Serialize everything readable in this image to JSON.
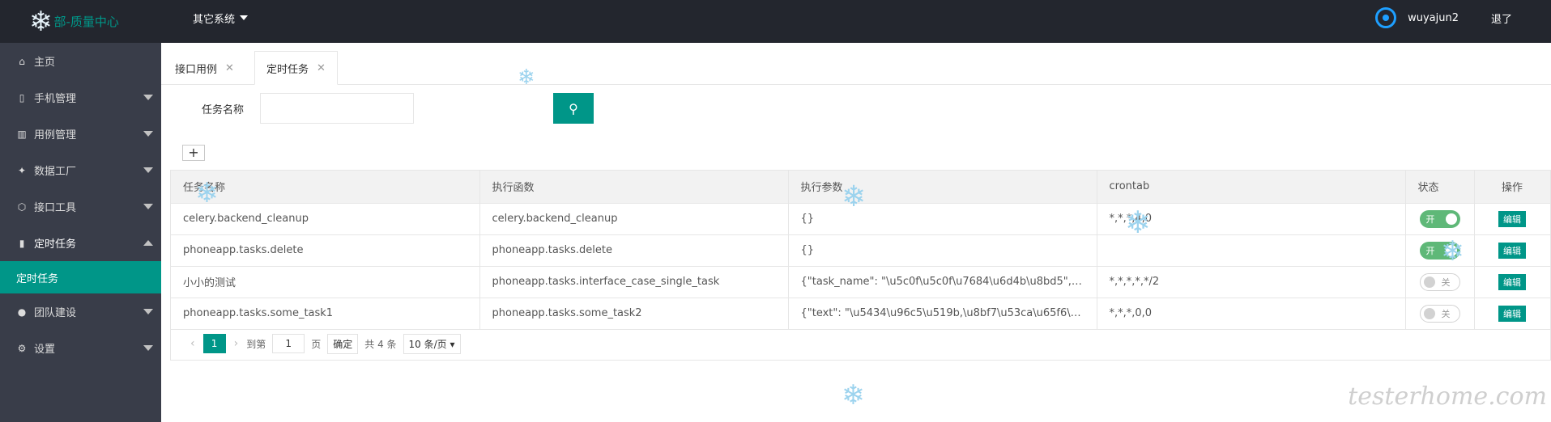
{
  "header": {
    "logo_text": "部-质量中心",
    "systems_menu": "其它系统",
    "username": "wuyajun2",
    "logout": "退了"
  },
  "sidebar": {
    "items": [
      {
        "label": "主页",
        "icon": "home-icon"
      },
      {
        "label": "手机管理",
        "icon": "phone-icon"
      },
      {
        "label": "用例管理",
        "icon": "book-icon"
      },
      {
        "label": "数据工厂",
        "icon": "factory-icon"
      },
      {
        "label": "接口工具",
        "icon": "cube-icon"
      },
      {
        "label": "定时任务",
        "icon": "clock-icon"
      },
      {
        "label": "团队建设",
        "icon": "user-icon"
      },
      {
        "label": "设置",
        "icon": "gear-icon"
      }
    ],
    "active_sub": "定时任务"
  },
  "tabs": [
    {
      "label": "接口用例"
    },
    {
      "label": "定时任务"
    }
  ],
  "search": {
    "label": "任务名称",
    "value": ""
  },
  "table": {
    "headers": [
      "任务名称",
      "执行函数",
      "执行参数",
      "crontab",
      "状态",
      "操作"
    ],
    "rows": [
      {
        "name": "celery.backend_cleanup",
        "func": "celery.backend_cleanup",
        "params": "{}",
        "crontab": "*,*,*,4,0",
        "status": "开",
        "status_on": true,
        "action": "编辑"
      },
      {
        "name": "phoneapp.tasks.delete",
        "func": "phoneapp.tasks.delete",
        "params": "{}",
        "crontab": "",
        "status": "开",
        "status_on": true,
        "action": "编辑"
      },
      {
        "name": "小小的测试",
        "func": "phoneapp.tasks.interface_case_single_task",
        "params": "{\"task_name\": \"\\u5c0f\\u5c0f\\u7684\\u6d4b\\u8bd5\", \"pr...",
        "crontab": "*,*,*,*,*/2",
        "status": "关",
        "status_on": false,
        "action": "编辑"
      },
      {
        "name": "phoneapp.tasks.some_task1",
        "func": "phoneapp.tasks.some_task2",
        "params": "{\"text\": \"\\u5434\\u96c5\\u519b,\\u8bf7\\u53ca\\u65f6\\u5f5...",
        "crontab": "*,*,*,0,0",
        "status": "关",
        "status_on": false,
        "action": "编辑"
      }
    ]
  },
  "pager": {
    "current": "1",
    "goto_label": "到第",
    "goto_value": "1",
    "page_unit": "页",
    "ok": "确定",
    "total": "共 4 条",
    "limit": "10 条/页"
  },
  "watermark": "testerhome.com"
}
